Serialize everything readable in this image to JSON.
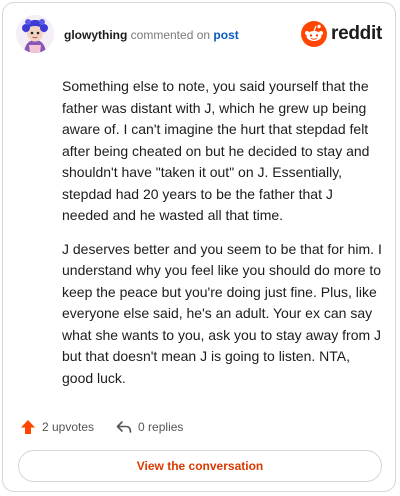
{
  "header": {
    "username": "glowything",
    "commented_text": "commented on",
    "post_link": "post",
    "brand": "reddit"
  },
  "comment": {
    "paragraphs": [
      "Something else to note, you said yourself that the father was distant with J, which he grew up being aware of. I can't imagine the hurt that stepdad felt after being cheated on but he decided to stay and shouldn't have \"taken it out\" on J. Essentially, stepdad had 20 years to be the father that J needed and he wasted all that time.",
      "J deserves better and you seem to be that for him. I understand why you feel like you should do more to keep the peace but you're doing just fine. Plus, like everyone else said, he's an adult. Your ex can say what she wants to you, ask you to stay away from J but that doesn't mean J is going to listen. NTA, good luck."
    ]
  },
  "actions": {
    "upvotes": "2 upvotes",
    "replies": "0 replies"
  },
  "footer": {
    "view_button": "View the conversation"
  },
  "colors": {
    "accent": "#d93a00",
    "link": "#0b5bbf",
    "upvote": "#ff4500"
  },
  "icons": {
    "upvote": "upvote-arrow-icon",
    "reply": "reply-arrow-icon",
    "logo": "reddit-snoo-icon"
  }
}
